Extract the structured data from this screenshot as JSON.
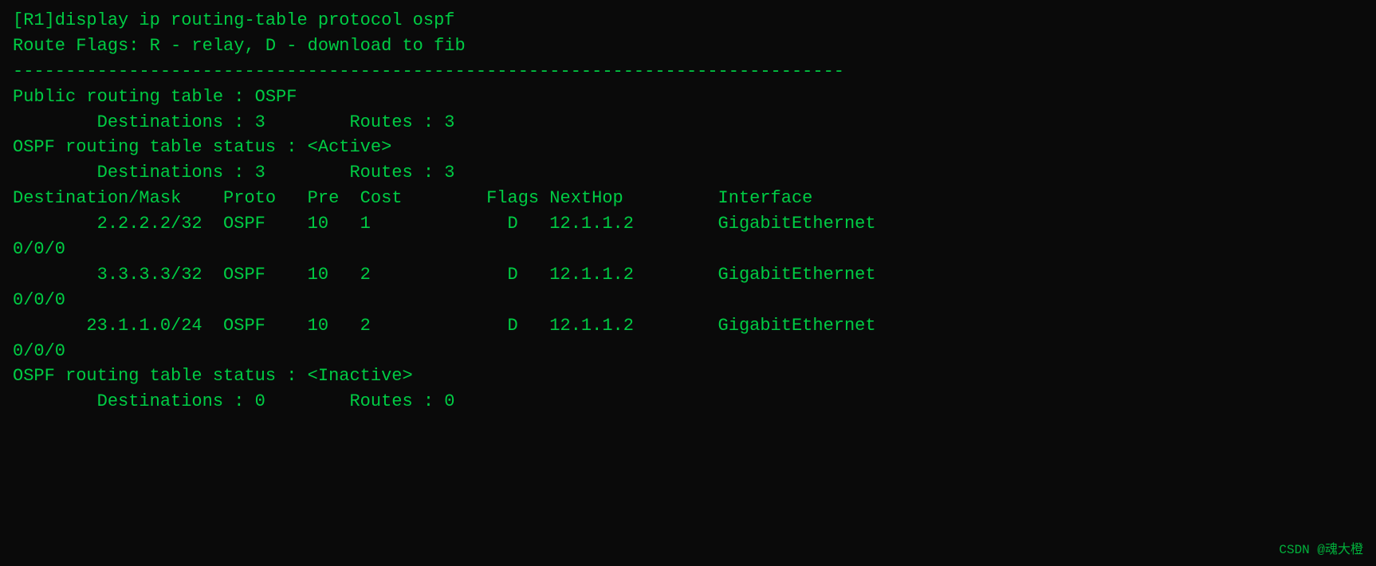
{
  "terminal": {
    "lines": [
      "[R1]display ip routing-table protocol ospf",
      "Route Flags: R - relay, D - download to fib",
      "-------------------------------------------------------------------------------",
      "Public routing table : OSPF",
      "        Destinations : 3        Routes : 3",
      "",
      "OSPF routing table status : <Active>",
      "        Destinations : 3        Routes : 3",
      "",
      "Destination/Mask    Proto   Pre  Cost        Flags NextHop         Interface",
      "",
      "        2.2.2.2/32  OSPF    10   1             D   12.1.1.2        GigabitEthernet",
      "0/0/0",
      "        3.3.3.3/32  OSPF    10   2             D   12.1.1.2        GigabitEthernet",
      "0/0/0",
      "       23.1.1.0/24  OSPF    10   2             D   12.1.1.2        GigabitEthernet",
      "0/0/0",
      "",
      "OSPF routing table status : <Inactive>",
      "        Destinations : 0        Routes : 0"
    ],
    "watermark": "CSDN @魂大橙"
  }
}
